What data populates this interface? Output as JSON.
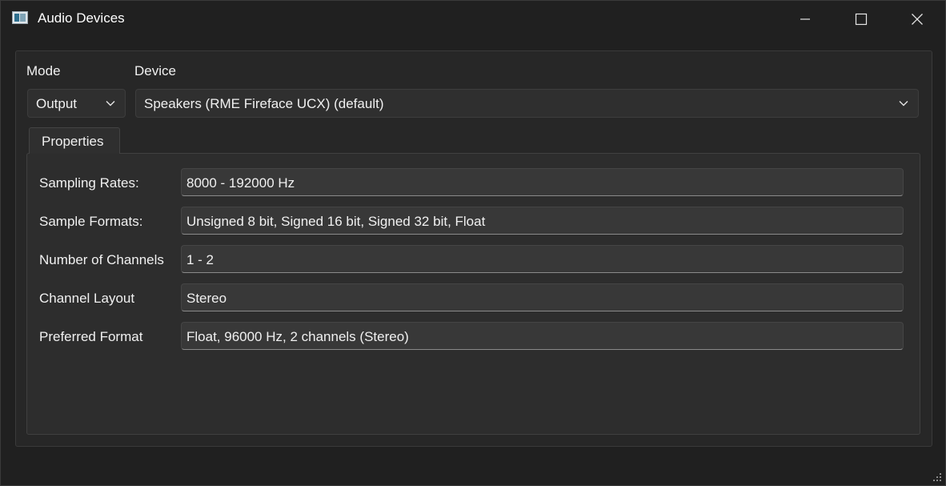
{
  "window": {
    "title": "Audio Devices"
  },
  "mode": {
    "label": "Mode",
    "value": "Output"
  },
  "device": {
    "label": "Device",
    "value": "Speakers (RME Fireface UCX) (default)"
  },
  "tabs": [
    {
      "label": "Properties",
      "active": true
    }
  ],
  "properties": [
    {
      "label": "Sampling Rates:",
      "value": "8000 - 192000 Hz"
    },
    {
      "label": "Sample Formats:",
      "value": "Unsigned 8 bit, Signed 16 bit, Signed 32 bit, Float"
    },
    {
      "label": "Number of Channels",
      "value": "1 - 2"
    },
    {
      "label": "Channel Layout",
      "value": "Stereo"
    },
    {
      "label": "Preferred Format",
      "value": "Float, 96000 Hz, 2 channels (Stereo)"
    }
  ],
  "icons": {
    "app": "audio-devices-app-icon",
    "minimize": "minimize-icon",
    "maximize": "maximize-icon",
    "close": "close-icon",
    "dropdown": "chevron-down-icon",
    "resize": "resize-grip-icon"
  },
  "colors": {
    "background": "#202020",
    "panel": "#2d2d2d",
    "field": "#383838",
    "text": "#f0f0f0"
  }
}
